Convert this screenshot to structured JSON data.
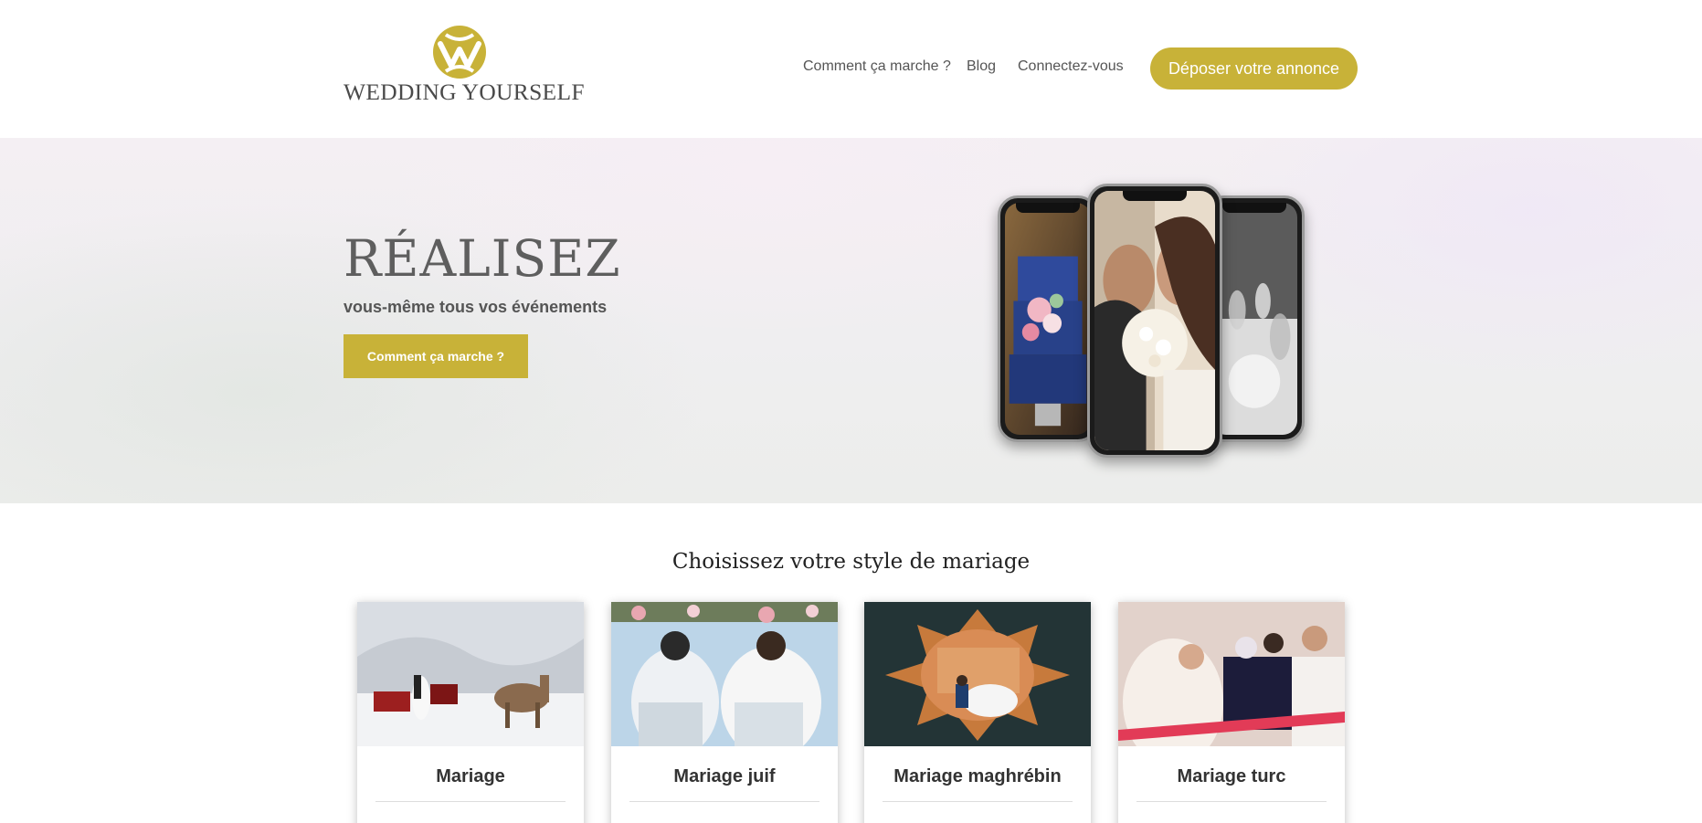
{
  "brand": {
    "name": "WEDDING YOURSELF",
    "accent_color": "#c8b238"
  },
  "nav": {
    "how_it_works": "Comment ça marche ?",
    "blog": "Blog",
    "login": "Connectez-vous",
    "post_ad": "Déposer votre annonce"
  },
  "hero": {
    "title": "RÉALISEZ",
    "subtitle": "vous-même tous vos événements",
    "cta": "Comment ça marche ?",
    "phone_images": [
      "wedding-cake-image",
      "couple-bouquet-image",
      "table-glasses-image"
    ]
  },
  "styles": {
    "heading": "Choisissez votre style de mariage",
    "cards": [
      {
        "title": "Mariage",
        "description": "",
        "image": "snow-sleigh-wedding-image"
      },
      {
        "title": "Mariage juif",
        "description": "",
        "image": "jewish-wedding-image"
      },
      {
        "title": "Mariage maghrébin",
        "description": "",
        "image": "maghrebi-wedding-image"
      },
      {
        "title": "Mariage turc",
        "description": "",
        "image": "turkish-wedding-image"
      }
    ]
  }
}
